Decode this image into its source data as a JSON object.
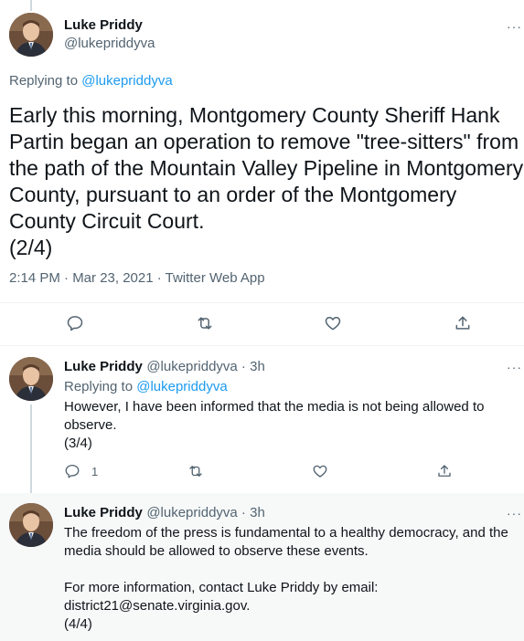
{
  "main_tweet": {
    "author_name": "Luke Priddy",
    "author_handle": "@lukepriddyva",
    "replying_to_prefix": "Replying to ",
    "replying_to_handle": "@lukepriddyva",
    "text": "Early this morning, Montgomery County Sheriff Hank Partin began an operation to remove \"tree-sitters\" from the path of the Mountain Valley Pipeline in Montgomery County, pursuant to an order of the Montgomery County Circuit Court.\n(2/4)",
    "timestamp": "2:14 PM · Mar 23, 2021 · Twitter Web App",
    "actions": {
      "reply_icon": "reply-icon",
      "retweet_icon": "retweet-icon",
      "like_icon": "heart-icon",
      "share_icon": "share-icon"
    }
  },
  "replies": [
    {
      "author_name": "Luke Priddy",
      "author_handle": "@lukepriddyva",
      "time_ago": " · 3h",
      "replying_to_prefix": "Replying to ",
      "replying_to_handle": "@lukepriddyva",
      "text": "However, I have been informed that the media is not being allowed to observe.\n(3/4)",
      "reply_count": "1"
    },
    {
      "author_name": "Luke Priddy",
      "author_handle": "@lukepriddyva",
      "time_ago": " · 3h",
      "text": "The freedom of the press is fundamental to a healthy democracy, and the media should be allowed to observe these events.\n\nFor more information, contact Luke Priddy by email: district21@senate.virginia.gov.\n(4/4)"
    }
  ],
  "more_label": "···",
  "colors": {
    "link_blue": "#1d9bf0",
    "secondary_text": "#536471",
    "highlight_bg": "#f7f9f9",
    "thread_line": "#cfd9de"
  }
}
